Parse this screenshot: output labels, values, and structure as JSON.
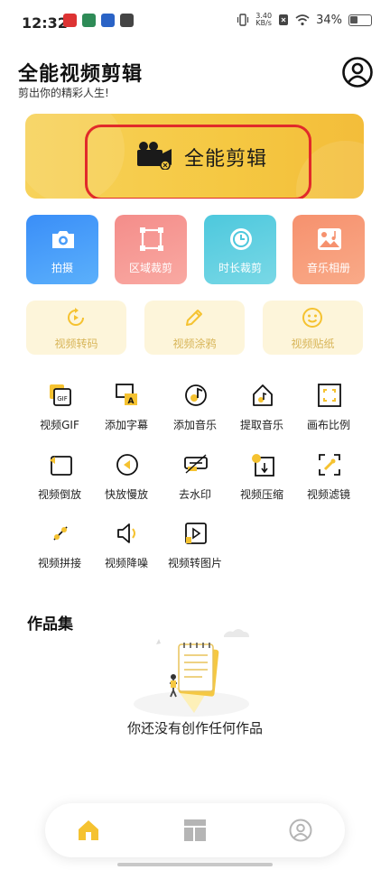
{
  "status_bar": {
    "time": "12:32",
    "net_speed_value": "3.40",
    "net_speed_unit": "KB/s",
    "battery": "34%"
  },
  "header": {
    "title": "全能视频剪辑",
    "subtitle": "剪出你的精彩人生!"
  },
  "banner": {
    "label": "全能剪辑",
    "highlight_color": "#e12a2a"
  },
  "big_tiles": [
    {
      "label": "拍摄",
      "icon": "camera-icon",
      "gradient": [
        "#3a8ef8",
        "#5bb0fb"
      ]
    },
    {
      "label": "区域裁剪",
      "icon": "crop-area-icon",
      "gradient": [
        "#f48d8a",
        "#f9a9a2"
      ]
    },
    {
      "label": "时长裁剪",
      "icon": "clock-icon",
      "gradient": [
        "#4dc8dd",
        "#79d8e6"
      ]
    },
    {
      "label": "音乐相册",
      "icon": "image-music-icon",
      "gradient": [
        "#f6916e",
        "#f9aa88"
      ]
    }
  ],
  "mid_tiles": [
    {
      "label": "视频转码",
      "icon": "rotate-play-icon"
    },
    {
      "label": "视频涂鸦",
      "icon": "pencil-icon"
    },
    {
      "label": "视频贴纸",
      "icon": "smiley-icon"
    }
  ],
  "tools": [
    {
      "label": "视频GIF",
      "icon": "gif-icon"
    },
    {
      "label": "添加字幕",
      "icon": "subtitle-icon"
    },
    {
      "label": "添加音乐",
      "icon": "music-note-icon"
    },
    {
      "label": "提取音乐",
      "icon": "extract-music-icon"
    },
    {
      "label": "画布比例",
      "icon": "canvas-ratio-icon"
    },
    {
      "label": "视频倒放",
      "icon": "reverse-icon"
    },
    {
      "label": "快放慢放",
      "icon": "speed-icon"
    },
    {
      "label": "去水印",
      "icon": "watermark-icon"
    },
    {
      "label": "视频压缩",
      "icon": "compress-icon"
    },
    {
      "label": "视频滤镜",
      "icon": "filter-icon"
    },
    {
      "label": "视频拼接",
      "icon": "splice-icon"
    },
    {
      "label": "视频降噪",
      "icon": "denoise-icon"
    },
    {
      "label": "视频转图片",
      "icon": "video-to-image-icon"
    }
  ],
  "works": {
    "title": "作品集",
    "empty_text": "你还没有创作任何作品"
  },
  "bottom_nav": [
    {
      "name": "home",
      "icon": "home-icon",
      "active": true
    },
    {
      "name": "templates",
      "icon": "layout-icon",
      "active": false
    },
    {
      "name": "profile",
      "icon": "user-icon",
      "active": false
    }
  ],
  "colors": {
    "accent": "#f5c842",
    "tool_yellow": "#f5c230",
    "mid_tile_bg": "#fdf5da",
    "mid_tile_text": "#d8b558"
  }
}
